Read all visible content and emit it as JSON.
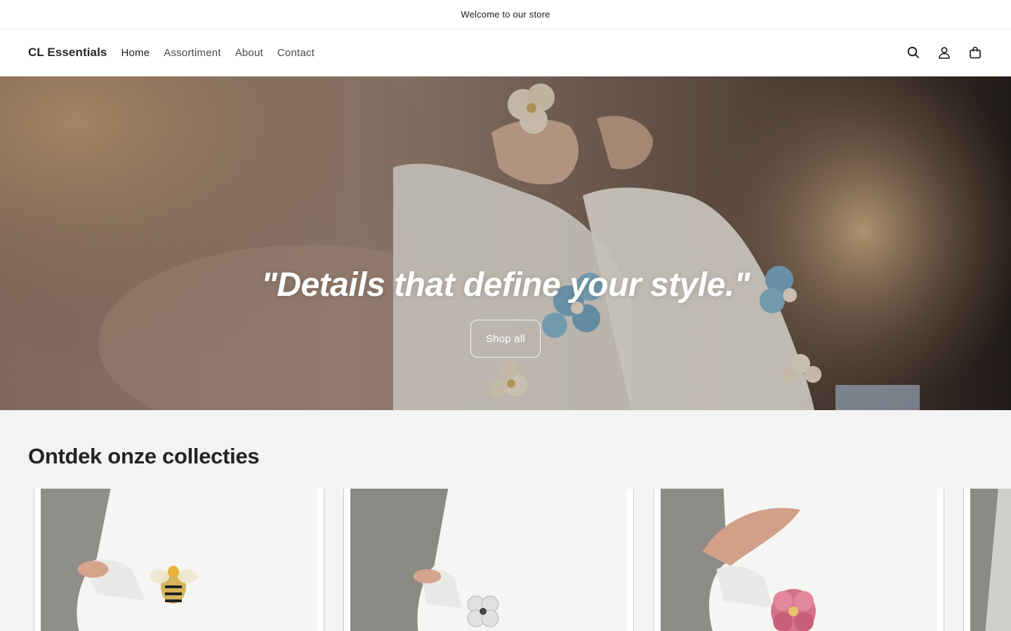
{
  "announcement": {
    "text": "Welcome to our store"
  },
  "header": {
    "logo": "CL Essentials",
    "nav": [
      {
        "label": "Home"
      },
      {
        "label": "Assortiment"
      },
      {
        "label": "About"
      },
      {
        "label": "Contact"
      }
    ],
    "icons": [
      "search-icon",
      "account-icon",
      "cart-icon"
    ]
  },
  "hero": {
    "title": "\"Details that define your style.\"",
    "button_label": "Shop all"
  },
  "collections": {
    "title": "Ontdek onze collecties",
    "cards": [
      {
        "image": "cuff-bee-brooch"
      },
      {
        "image": "cuff-crystal-brooch"
      },
      {
        "image": "cuff-pink-flower-brooch"
      },
      {
        "image": "cuff-partial"
      }
    ]
  },
  "colors": {
    "accent_border": "#d9c7bd",
    "collections_bg": "#f3f3f3"
  }
}
